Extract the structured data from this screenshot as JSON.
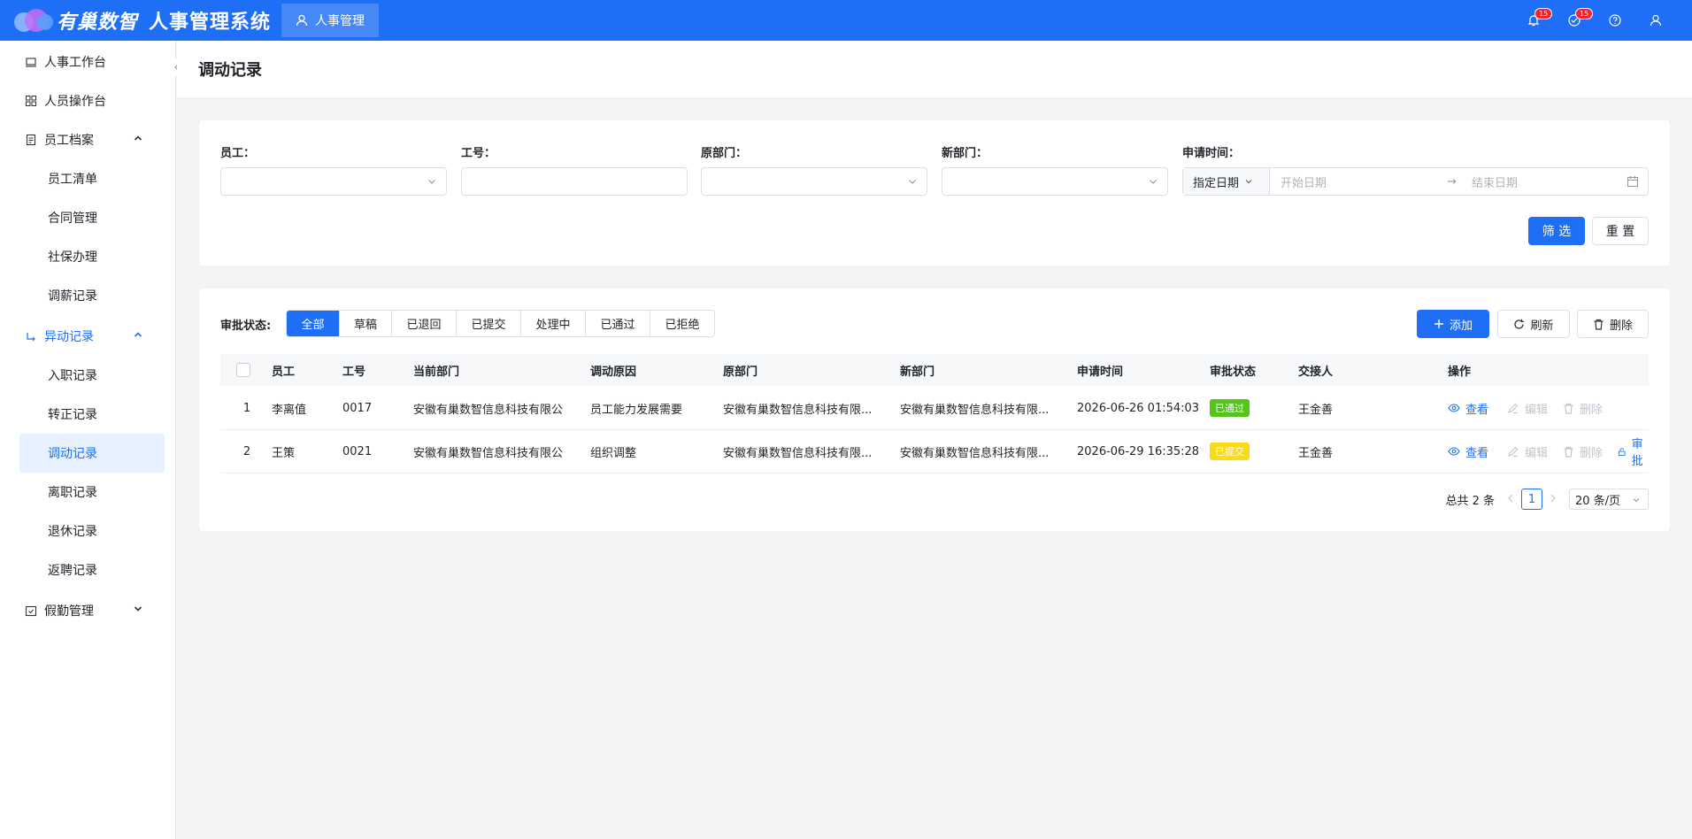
{
  "header": {
    "logo_text": "有巢数智",
    "app_title": "人事管理系统",
    "nav_tab": "人事管理",
    "badge_1": "15",
    "badge_2": "15"
  },
  "sidebar": {
    "items": [
      {
        "label": "人事工作台"
      },
      {
        "label": "人员操作台"
      },
      {
        "label": "员工档案"
      },
      {
        "label": "员工清单"
      },
      {
        "label": "合同管理"
      },
      {
        "label": "社保办理"
      },
      {
        "label": "调薪记录"
      },
      {
        "label": "异动记录"
      },
      {
        "label": "入职记录"
      },
      {
        "label": "转正记录"
      },
      {
        "label": "调动记录"
      },
      {
        "label": "离职记录"
      },
      {
        "label": "退休记录"
      },
      {
        "label": "返聘记录"
      },
      {
        "label": "假勤管理"
      }
    ]
  },
  "page_title": "调动记录",
  "filters": {
    "employee_label": "员工：",
    "id_label": "工号：",
    "old_dept_label": "原部门：",
    "new_dept_label": "新部门：",
    "apply_time_label": "申请时间：",
    "date_mode": "指定日期",
    "start_placeholder": "开始日期",
    "end_placeholder": "结束日期",
    "filter_btn": "筛 选",
    "reset_btn": "重 置"
  },
  "toolbar": {
    "status_label": "审批状态:",
    "status_tabs": [
      "全部",
      "草稿",
      "已退回",
      "已提交",
      "处理中",
      "已通过",
      "已拒绝"
    ],
    "add_btn": "添加",
    "refresh_btn": "刷新",
    "delete_btn": "删除"
  },
  "table": {
    "columns": [
      "员工",
      "工号",
      "当前部门",
      "调动原因",
      "原部门",
      "新部门",
      "申请时间",
      "审批状态",
      "交接人",
      "操作"
    ],
    "rows": [
      {
        "index": "1",
        "employee": "李离值",
        "id": "0017",
        "current_dept": "安徽有巢数智信息科技有限公",
        "reason": "员工能力发展需要",
        "old_dept": "安徽有巢数智信息科技有限...",
        "new_dept": "安徽有巢数智信息科技有限...",
        "time": "2026-06-26 01:54:03",
        "status": "已通过",
        "status_color": "#52c41a",
        "handover": "王金善"
      },
      {
        "index": "2",
        "employee": "王策",
        "id": "0021",
        "current_dept": "安徽有巢数智信息科技有限公",
        "reason": "组织调整",
        "old_dept": "安徽有巢数智信息科技有限...",
        "new_dept": "安徽有巢数智信息科技有限...",
        "time": "2026-06-29 16:35:28",
        "status": "已提交",
        "status_color": "#fadb14",
        "handover": "王金善"
      }
    ],
    "actions": {
      "view": "查看",
      "edit": "编辑",
      "delete": "删除",
      "approve": "审批"
    }
  },
  "pager": {
    "total": "总共 2 条",
    "page": "1",
    "page_size": "20 条/页"
  },
  "colors": {
    "primary": "#1e6ff5"
  }
}
